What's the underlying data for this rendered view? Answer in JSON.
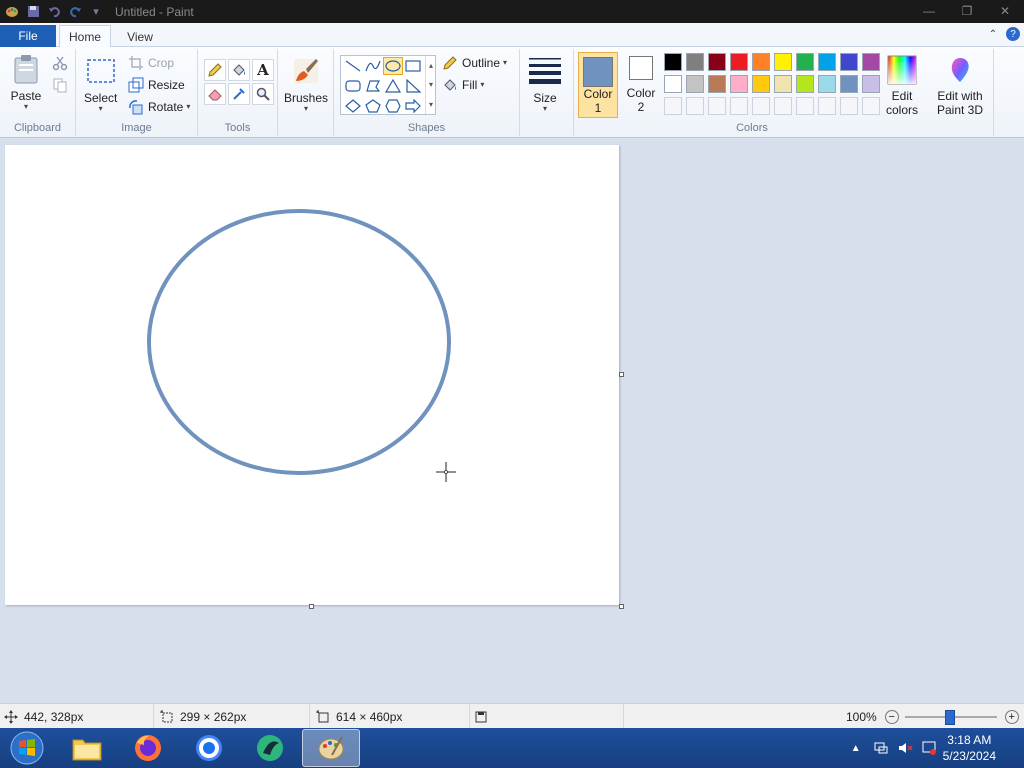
{
  "titlebar": {
    "title": "Untitled - Paint"
  },
  "tabs": {
    "file": "File",
    "home": "Home",
    "view": "View"
  },
  "ribbon": {
    "clipboard": {
      "label": "Clipboard",
      "paste": "Paste"
    },
    "image": {
      "label": "Image",
      "select": "Select",
      "crop": "Crop",
      "resize": "Resize",
      "rotate": "Rotate"
    },
    "tools": {
      "label": "Tools"
    },
    "brushes": {
      "label": "Brushes"
    },
    "shapes": {
      "label": "Shapes",
      "outline": "Outline",
      "fill": "Fill"
    },
    "size": {
      "label": "Size"
    },
    "colors": {
      "label": "Colors",
      "color1_line1": "Color",
      "color1_line2": "1",
      "color2_line1": "Color",
      "color2_line2": "2",
      "edit_line1": "Edit",
      "edit_line2": "colors",
      "paint3d_line1": "Edit with",
      "paint3d_line2": "Paint 3D",
      "color1_value": "#7092be",
      "color2_value": "#ffffff",
      "palette_row1": [
        "#000000",
        "#7f7f7f",
        "#880015",
        "#ed1c24",
        "#ff7f27",
        "#fff200",
        "#22b14c",
        "#00a2e8",
        "#3f48cc",
        "#a349a4"
      ],
      "palette_row2": [
        "#ffffff",
        "#c3c3c3",
        "#b97a57",
        "#ffaec9",
        "#ffc90e",
        "#efe4b0",
        "#b5e61d",
        "#99d9ea",
        "#7092be",
        "#c8bfe7"
      ]
    }
  },
  "statusbar": {
    "cursor_pos": "442, 328px",
    "selection_size": "299 × 262px",
    "canvas_size": "614 × 460px",
    "zoom": "100%"
  },
  "taskbar": {
    "time": "3:18 AM",
    "date": "5/23/2024"
  }
}
